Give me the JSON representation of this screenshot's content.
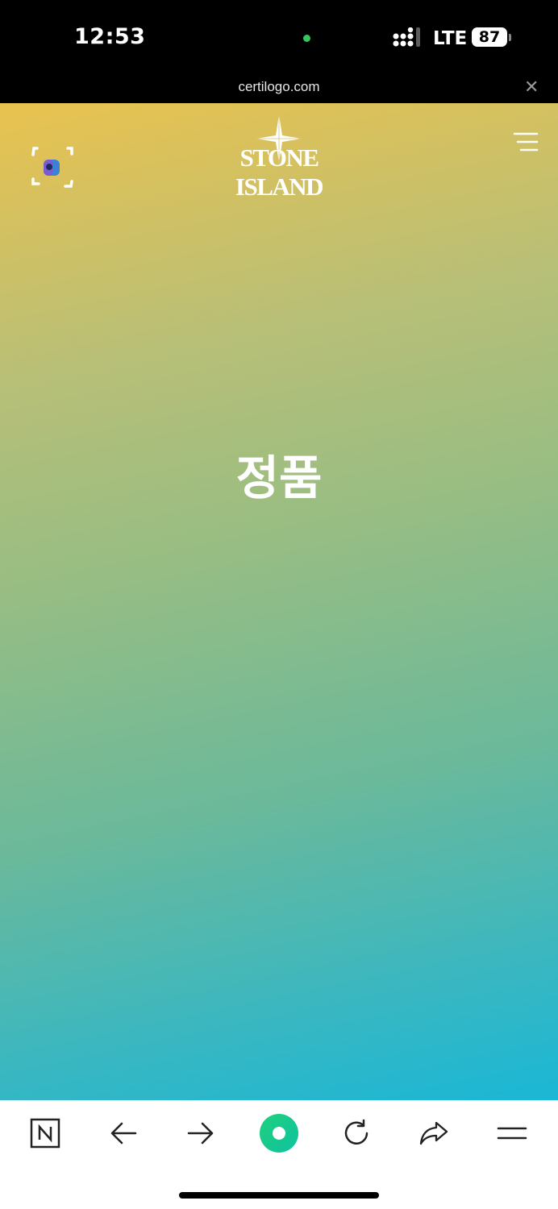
{
  "status_bar": {
    "time": "12:53",
    "network": "LTE",
    "battery": "87"
  },
  "browser": {
    "url": "certilogo.com",
    "close_icon": "close-icon"
  },
  "page": {
    "brand": "STONE ISLAND",
    "result": "정품"
  },
  "toolbar": {
    "items": [
      "naver-home-icon",
      "back-arrow-icon",
      "forward-arrow-icon",
      "green-dot-icon",
      "reload-icon",
      "share-icon",
      "menu-icon"
    ]
  },
  "colors": {
    "gradient_top": "#e9c24f",
    "gradient_mid": "#96bd84",
    "gradient_bottom": "#1ab7d6",
    "accent_green": "#16c98a"
  }
}
